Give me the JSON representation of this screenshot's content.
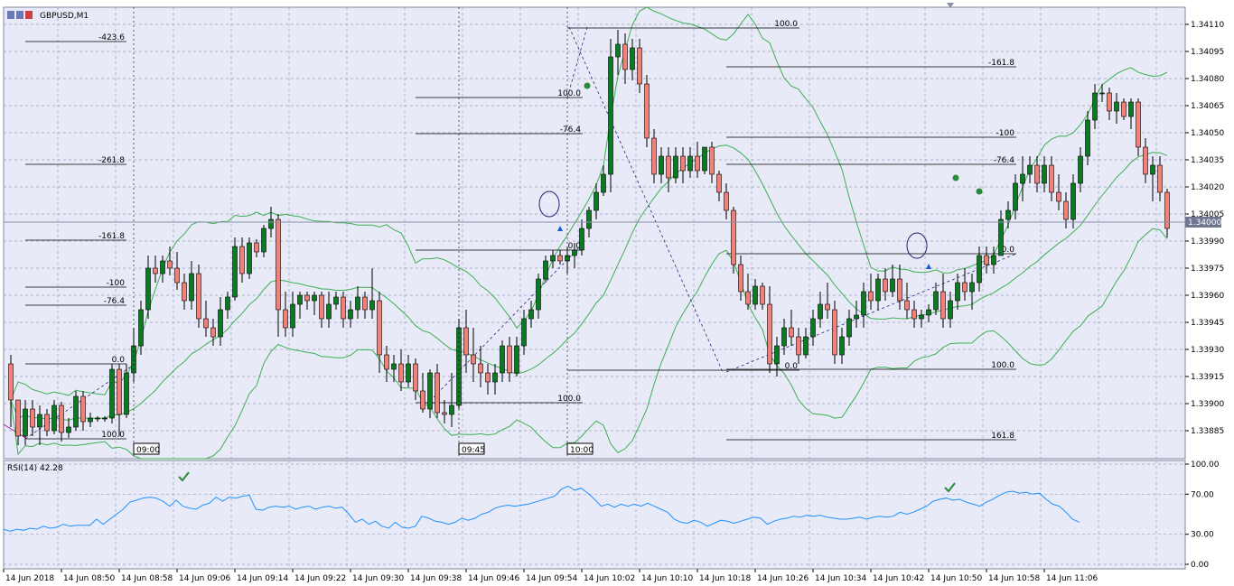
{
  "window": {
    "title": "GBPUSD,M1"
  },
  "main_panel": {
    "price_ticks": [
      "1.34110",
      "1.34095",
      "1.34080",
      "1.34065",
      "1.34050",
      "1.34035",
      "1.34020",
      "1.34005",
      "1.33990",
      "1.33975",
      "1.33960",
      "1.33945",
      "1.33930",
      "1.33915",
      "1.33900",
      "1.33885"
    ],
    "current_price": "1.34000",
    "session_markers": [
      "09:00",
      "09:45",
      "10:00"
    ]
  },
  "fibo": {
    "group1": [
      "-423.6",
      "-261.8",
      "-161.8",
      "-100",
      "-76.4",
      "0.0",
      "100.0"
    ],
    "group2": [
      "100.0",
      "-76.4",
      "0.0",
      "100.0"
    ],
    "group3": [
      "100.0",
      "-161.8",
      "-100",
      "-76.4",
      "0.0",
      "0.0",
      "100.0",
      "161.8"
    ]
  },
  "rsi_panel": {
    "label": "RSI(14) 42.28",
    "ticks": [
      "100.00",
      "70.00",
      "30.00",
      "0.00"
    ]
  },
  "time_axis": [
    "14 Jun 2018",
    "14 Jun 08:50",
    "14 Jun 08:58",
    "14 Jun 09:06",
    "14 Jun 09:14",
    "14 Jun 09:22",
    "14 Jun 09:30",
    "14 Jun 09:38",
    "14 Jun 09:46",
    "14 Jun 09:54",
    "14 Jun 10:02",
    "14 Jun 10:10",
    "14 Jun 10:18",
    "14 Jun 10:26",
    "14 Jun 10:34",
    "14 Jun 10:42",
    "14 Jun 10:50",
    "14 Jun 10:58",
    "14 Jun 11:06"
  ],
  "colors": {
    "bull": "#0b7a22",
    "bear": "#f08078",
    "bands": "#3cb050",
    "rsi": "#1e90ff",
    "grid": "#9aa0b8",
    "bg": "#e8eaf8",
    "marker": "#1060d0",
    "wick": "#000000"
  },
  "chart_data": {
    "type": "candlestick",
    "symbol": "GBPUSD",
    "timeframe": "M1",
    "y_range": [
      1.33875,
      1.3412
    ],
    "candles": [
      [
        1.33925,
        1.3393,
        1.3389,
        1.33905
      ],
      [
        1.33905,
        1.33905,
        1.3388,
        1.33885
      ],
      [
        1.33885,
        1.33905,
        1.3388,
        1.339
      ],
      [
        1.339,
        1.33905,
        1.33885,
        1.3389
      ],
      [
        1.3389,
        1.33902,
        1.3388,
        1.33897
      ],
      [
        1.33897,
        1.339,
        1.33885,
        1.33888
      ],
      [
        1.33888,
        1.33905,
        1.33886,
        1.33902
      ],
      [
        1.33902,
        1.33904,
        1.33882,
        1.33887
      ],
      [
        1.33887,
        1.33895,
        1.33884,
        1.3389
      ],
      [
        1.3389,
        1.3391,
        1.33888,
        1.33907
      ],
      [
        1.33907,
        1.3391,
        1.33888,
        1.33893
      ],
      [
        1.33893,
        1.33898,
        1.3389,
        1.33895
      ],
      [
        1.33895,
        1.33896,
        1.33893,
        1.33895
      ],
      [
        1.33895,
        1.33896,
        1.33893,
        1.33895
      ],
      [
        1.33895,
        1.33925,
        1.33892,
        1.33922
      ],
      [
        1.33922,
        1.33925,
        1.33885,
        1.33897
      ],
      [
        1.33897,
        1.33925,
        1.33895,
        1.3392
      ],
      [
        1.3392,
        1.33945,
        1.33915,
        1.33935
      ],
      [
        1.33935,
        1.3396,
        1.3393,
        1.33955
      ],
      [
        1.33955,
        1.33985,
        1.3395,
        1.33978
      ],
      [
        1.33978,
        1.33985,
        1.3397,
        1.33975
      ],
      [
        1.33975,
        1.33985,
        1.3397,
        1.33982
      ],
      [
        1.33982,
        1.3399,
        1.33974,
        1.33978
      ],
      [
        1.33978,
        1.33987,
        1.33966,
        1.3397
      ],
      [
        1.3397,
        1.33975,
        1.33955,
        1.3396
      ],
      [
        1.3396,
        1.33982,
        1.33955,
        1.33975
      ],
      [
        1.33975,
        1.3398,
        1.33945,
        1.3395
      ],
      [
        1.3395,
        1.3396,
        1.3394,
        1.33945
      ],
      [
        1.33945,
        1.3395,
        1.33935,
        1.3394
      ],
      [
        1.3394,
        1.33962,
        1.33935,
        1.33955
      ],
      [
        1.33955,
        1.33965,
        1.3395,
        1.33962
      ],
      [
        1.33962,
        1.33995,
        1.3396,
        1.3399
      ],
      [
        1.3399,
        1.33995,
        1.3397,
        1.33975
      ],
      [
        1.33975,
        1.33995,
        1.33972,
        1.33992
      ],
      [
        1.33992,
        1.33994,
        1.33984,
        1.33987
      ],
      [
        1.33987,
        1.34002,
        1.33984,
        1.34
      ],
      [
        1.34,
        1.34012,
        1.33995,
        1.34005
      ],
      [
        1.34005,
        1.34008,
        1.3394,
        1.33955
      ],
      [
        1.33955,
        1.33965,
        1.3394,
        1.33945
      ],
      [
        1.33945,
        1.33965,
        1.3394,
        1.33958
      ],
      [
        1.33958,
        1.33965,
        1.3395,
        1.33963
      ],
      [
        1.33963,
        1.33965,
        1.33955,
        1.3396
      ],
      [
        1.3396,
        1.33965,
        1.33952,
        1.33963
      ],
      [
        1.33963,
        1.33965,
        1.33945,
        1.3395
      ],
      [
        1.3395,
        1.33965,
        1.33945,
        1.33958
      ],
      [
        1.33958,
        1.33965,
        1.33955,
        1.33962
      ],
      [
        1.33962,
        1.33965,
        1.33945,
        1.3395
      ],
      [
        1.3395,
        1.3396,
        1.33945,
        1.33955
      ],
      [
        1.33955,
        1.33968,
        1.3395,
        1.33962
      ],
      [
        1.33962,
        1.33965,
        1.3395,
        1.33955
      ],
      [
        1.33955,
        1.33978,
        1.3395,
        1.3396
      ],
      [
        1.3396,
        1.33965,
        1.3392,
        1.3393
      ],
      [
        1.3393,
        1.33935,
        1.33915,
        1.33922
      ],
      [
        1.33922,
        1.3393,
        1.33915,
        1.33925
      ],
      [
        1.33925,
        1.33933,
        1.3391,
        1.33915
      ],
      [
        1.33915,
        1.3393,
        1.33912,
        1.33925
      ],
      [
        1.33925,
        1.33928,
        1.33905,
        1.3391
      ],
      [
        1.3391,
        1.3392,
        1.33898,
        1.339
      ],
      [
        1.339,
        1.33922,
        1.33895,
        1.3392
      ],
      [
        1.3392,
        1.33925,
        1.33895,
        1.33898
      ],
      [
        1.33898,
        1.33905,
        1.33892,
        1.33897
      ],
      [
        1.33897,
        1.3392,
        1.3389,
        1.33902
      ],
      [
        1.33902,
        1.3395,
        1.339,
        1.33945
      ],
      [
        1.33945,
        1.33955,
        1.3392,
        1.3393
      ],
      [
        1.3393,
        1.33945,
        1.33915,
        1.33925
      ],
      [
        1.33925,
        1.33935,
        1.33912,
        1.3392
      ],
      [
        1.3392,
        1.33925,
        1.33908,
        1.33915
      ],
      [
        1.33915,
        1.33925,
        1.33908,
        1.3392
      ],
      [
        1.3392,
        1.33938,
        1.33915,
        1.33935
      ],
      [
        1.33935,
        1.3394,
        1.33915,
        1.3392
      ],
      [
        1.3392,
        1.3394,
        1.33918,
        1.33935
      ],
      [
        1.33935,
        1.33955,
        1.3393,
        1.3395
      ],
      [
        1.3395,
        1.3396,
        1.33945,
        1.33955
      ],
      [
        1.33955,
        1.33975,
        1.3395,
        1.33972
      ],
      [
        1.33972,
        1.33985,
        1.3397,
        1.33982
      ],
      [
        1.33982,
        1.33988,
        1.33978,
        1.33985
      ],
      [
        1.33985,
        1.33988,
        1.3398,
        1.33982
      ],
      [
        1.33982,
        1.3399,
        1.33975,
        1.33985
      ],
      [
        1.33985,
        1.33992,
        1.33978,
        1.33988
      ],
      [
        1.33988,
        1.34005,
        1.33985,
        1.34
      ],
      [
        1.34,
        1.34012,
        1.33995,
        1.3401
      ],
      [
        1.3401,
        1.34025,
        1.34005,
        1.3402
      ],
      [
        1.3402,
        1.34035,
        1.34018,
        1.3403
      ],
      [
        1.3403,
        1.34105,
        1.3402,
        1.34095
      ],
      [
        1.34095,
        1.3411,
        1.34085,
        1.34102
      ],
      [
        1.34102,
        1.34108,
        1.3408,
        1.34088
      ],
      [
        1.34088,
        1.34105,
        1.34082,
        1.341
      ],
      [
        1.341,
        1.34105,
        1.34075,
        1.3408
      ],
      [
        1.3408,
        1.34085,
        1.34045,
        1.3405
      ],
      [
        1.3405,
        1.34055,
        1.34025,
        1.3403
      ],
      [
        1.3403,
        1.34045,
        1.34025,
        1.3404
      ],
      [
        1.3404,
        1.34045,
        1.3402,
        1.34028
      ],
      [
        1.34028,
        1.34045,
        1.34025,
        1.3404
      ],
      [
        1.3404,
        1.34045,
        1.34025,
        1.34032
      ],
      [
        1.34032,
        1.34045,
        1.34028,
        1.3404
      ],
      [
        1.3404,
        1.34048,
        1.34028,
        1.34032
      ],
      [
        1.34032,
        1.34045,
        1.3403,
        1.34045
      ],
      [
        1.34045,
        1.34048,
        1.34025,
        1.3403
      ],
      [
        1.3403,
        1.34032,
        1.34015,
        1.3402
      ],
      [
        1.3402,
        1.34025,
        1.34005,
        1.3401
      ],
      [
        1.3401,
        1.34012,
        1.33975,
        1.3398
      ],
      [
        1.3398,
        1.33985,
        1.3396,
        1.33965
      ],
      [
        1.33965,
        1.33975,
        1.33955,
        1.33958
      ],
      [
        1.33958,
        1.33972,
        1.33955,
        1.33968
      ],
      [
        1.33968,
        1.3397,
        1.33955,
        1.33958
      ],
      [
        1.33958,
        1.33968,
        1.3392,
        1.33925
      ],
      [
        1.33925,
        1.3394,
        1.33918,
        1.33935
      ],
      [
        1.33935,
        1.3395,
        1.3393,
        1.33945
      ],
      [
        1.33945,
        1.33955,
        1.33935,
        1.3394
      ],
      [
        1.3394,
        1.33945,
        1.33925,
        1.3393
      ],
      [
        1.3393,
        1.33945,
        1.33928,
        1.3394
      ],
      [
        1.3394,
        1.33955,
        1.33935,
        1.3395
      ],
      [
        1.3395,
        1.33965,
        1.33945,
        1.33958
      ],
      [
        1.33958,
        1.3397,
        1.3395,
        1.33955
      ],
      [
        1.33955,
        1.3396,
        1.33925,
        1.3393
      ],
      [
        1.3393,
        1.33945,
        1.33925,
        1.3394
      ],
      [
        1.3394,
        1.33955,
        1.33935,
        1.3395
      ],
      [
        1.3395,
        1.3396,
        1.33945,
        1.33952
      ],
      [
        1.33952,
        1.3397,
        1.33945,
        1.33965
      ],
      [
        1.33965,
        1.33975,
        1.33955,
        1.3396
      ],
      [
        1.3396,
        1.33975,
        1.33955,
        1.33972
      ],
      [
        1.33972,
        1.33978,
        1.3396,
        1.33965
      ],
      [
        1.33965,
        1.3398,
        1.33962,
        1.33972
      ],
      [
        1.33972,
        1.3398,
        1.33955,
        1.3396
      ],
      [
        1.3396,
        1.3397,
        1.3395,
        1.33955
      ],
      [
        1.33955,
        1.3396,
        1.33945,
        1.3395
      ],
      [
        1.3395,
        1.33955,
        1.33945,
        1.33952
      ],
      [
        1.33952,
        1.33958,
        1.33948,
        1.33955
      ],
      [
        1.33955,
        1.3397,
        1.33952,
        1.33965
      ],
      [
        1.33965,
        1.33975,
        1.33945,
        1.3395
      ],
      [
        1.3395,
        1.33965,
        1.33945,
        1.3396
      ],
      [
        1.3396,
        1.33975,
        1.33955,
        1.3397
      ],
      [
        1.3397,
        1.33978,
        1.3396,
        1.33965
      ],
      [
        1.33965,
        1.33975,
        1.33955,
        1.3397
      ],
      [
        1.3397,
        1.3399,
        1.33965,
        1.33985
      ],
      [
        1.33985,
        1.3399,
        1.33975,
        1.3398
      ],
      [
        1.3398,
        1.3399,
        1.33975,
        1.33985
      ],
      [
        1.33985,
        1.3401,
        1.33985,
        1.34005
      ],
      [
        1.34005,
        1.34015,
        1.34,
        1.3401
      ],
      [
        1.3401,
        1.3403,
        1.34005,
        1.34025
      ],
      [
        1.34025,
        1.3404,
        1.34015,
        1.3403
      ],
      [
        1.3403,
        1.3404,
        1.34025,
        1.34035
      ],
      [
        1.34035,
        1.3404,
        1.3402,
        1.34025
      ],
      [
        1.34025,
        1.3404,
        1.3402,
        1.34035
      ],
      [
        1.34035,
        1.3404,
        1.34015,
        1.3402
      ],
      [
        1.3402,
        1.3403,
        1.3401,
        1.34015
      ],
      [
        1.34015,
        1.3402,
        1.34,
        1.34005
      ],
      [
        1.34005,
        1.3403,
        1.34,
        1.34025
      ],
      [
        1.34025,
        1.34045,
        1.3402,
        1.3404
      ],
      [
        1.3404,
        1.34065,
        1.34035,
        1.3406
      ],
      [
        1.3406,
        1.3408,
        1.34055,
        1.34075
      ],
      [
        1.34075,
        1.3408,
        1.3407,
        1.34075
      ],
      [
        1.34075,
        1.34078,
        1.3406,
        1.34065
      ],
      [
        1.34065,
        1.34075,
        1.34058,
        1.3407
      ],
      [
        1.3407,
        1.34072,
        1.3406,
        1.34062
      ],
      [
        1.34062,
        1.34072,
        1.34055,
        1.3407
      ],
      [
        1.3407,
        1.34072,
        1.3404,
        1.34045
      ],
      [
        1.34045,
        1.3405,
        1.34025,
        1.3403
      ],
      [
        1.3403,
        1.3404,
        1.34015,
        1.34035
      ],
      [
        1.34035,
        1.3404,
        1.34015,
        1.3402
      ],
      [
        1.3402,
        1.34022,
        1.33995,
        1.34
      ]
    ],
    "rsi": {
      "name": "RSI(14)",
      "levels": [
        30,
        70
      ],
      "last": 42.28,
      "values": [
        35,
        33,
        35,
        34,
        36,
        35,
        38,
        36,
        37,
        40,
        38,
        39,
        39,
        39,
        45,
        40,
        45,
        50,
        55,
        62,
        64,
        66,
        67,
        66,
        63,
        58,
        64,
        58,
        56,
        55,
        59,
        61,
        67,
        63,
        67,
        66,
        68,
        69,
        55,
        54,
        57,
        58,
        57,
        58,
        55,
        57,
        58,
        55,
        57,
        58,
        56,
        57,
        50,
        42,
        45,
        40,
        43,
        38,
        36,
        42,
        37,
        36,
        38,
        48,
        46,
        43,
        42,
        40,
        42,
        46,
        44,
        46,
        50,
        52,
        56,
        58,
        59,
        58,
        59,
        60,
        62,
        64,
        66,
        68,
        75,
        78,
        74,
        76,
        71,
        65,
        58,
        60,
        57,
        60,
        58,
        60,
        58,
        61,
        58,
        55,
        52,
        45,
        42,
        41,
        44,
        42,
        38,
        41,
        44,
        43,
        41,
        43,
        45,
        47,
        46,
        40,
        43,
        45,
        46,
        48,
        47,
        49,
        48,
        49,
        47,
        46,
        45,
        45,
        46,
        47,
        45,
        47,
        48,
        47,
        48,
        52,
        50,
        52,
        55,
        58,
        63,
        65,
        66,
        64,
        65,
        62,
        60,
        58,
        62,
        65,
        69,
        72,
        73,
        71,
        72,
        70,
        71,
        65,
        60,
        58,
        52,
        45,
        42
      ]
    }
  }
}
